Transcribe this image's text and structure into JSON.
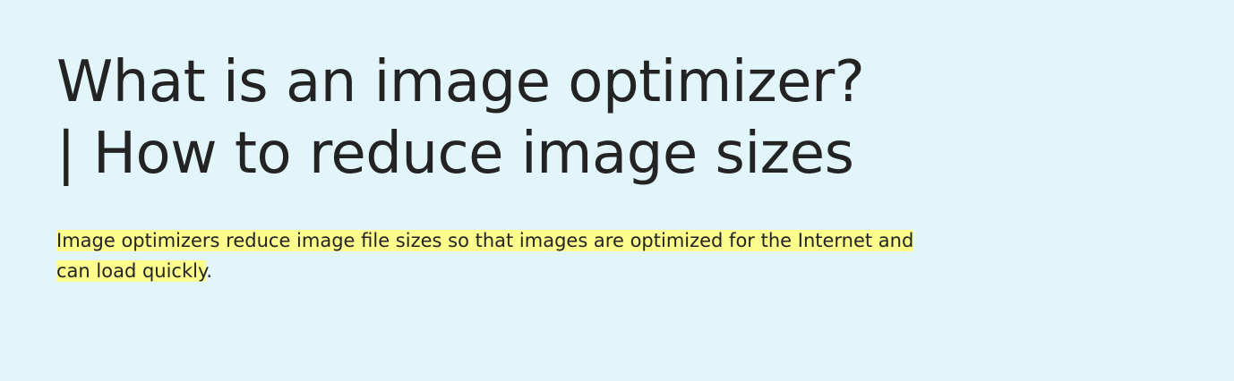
{
  "article": {
    "title_line_1": "What is an image optimizer?",
    "title_line_2": "| How to reduce image sizes",
    "summary_highlighted": "Image optimizers reduce image file sizes so that images are optimized for the Internet and can load quickly",
    "summary_tail": "."
  },
  "colors": {
    "background": "#e1f5fb",
    "text": "#232323",
    "highlight": "#fcfd8c"
  }
}
